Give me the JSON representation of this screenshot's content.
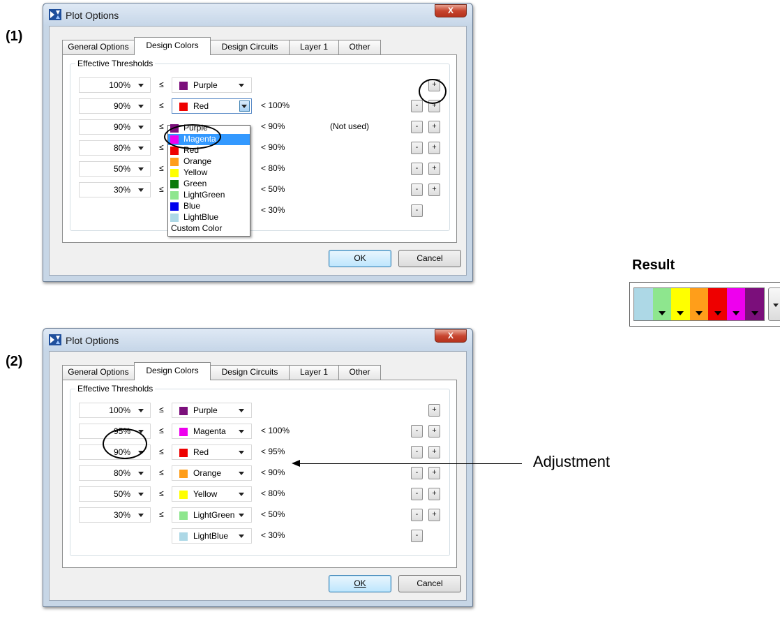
{
  "steps": [
    "(1)",
    "(2)"
  ],
  "dialog": {
    "title": "Plot Options",
    "close_glyph": "X",
    "tabs": [
      "General Options",
      "Design Colors",
      "Design Circuits",
      "Layer 1",
      "Other"
    ],
    "group_title": "Effective Thresholds",
    "le_symbol": "≤",
    "ok_label": "OK",
    "cancel_label": "Cancel",
    "minus": "-",
    "plus": "+"
  },
  "colors": {
    "Purple": "#7b0f7b",
    "Magenta": "#ee00ee",
    "Red": "#ee0000",
    "Orange": "#ff9e1a",
    "Yellow": "#ffff00",
    "Green": "#0b7a0b",
    "LightGreen": "#8ee68e",
    "Blue": "#0000ee",
    "LightBlue": "#add8e6"
  },
  "dialog1": {
    "rows": [
      {
        "pct": "100%",
        "color": "Purple",
        "lt": ""
      },
      {
        "pct": "90%",
        "color": "Red",
        "lt": "< 100%"
      },
      {
        "pct": "90%",
        "color": "",
        "lt": "< 90%",
        "note": "(Not used)"
      },
      {
        "pct": "80%",
        "color": "",
        "lt": "< 90%"
      },
      {
        "pct": "50%",
        "color": "",
        "lt": "< 80%"
      },
      {
        "pct": "30%",
        "color": "",
        "lt": "< 50%"
      },
      {
        "pct": "",
        "color": "",
        "lt": "< 30%"
      }
    ],
    "dropdown_items": [
      "Purple",
      "Magenta",
      "Red",
      "Orange",
      "Yellow",
      "Green",
      "LightGreen",
      "Blue",
      "LightBlue"
    ],
    "dropdown_selected": "Magenta",
    "custom_color_label": "Custom Color"
  },
  "dialog2": {
    "rows": [
      {
        "pct": "100%",
        "color": "Purple",
        "lt": ""
      },
      {
        "pct": "95%",
        "color": "Magenta",
        "lt": "< 100%"
      },
      {
        "pct": "90%",
        "color": "Red",
        "lt": "< 95%"
      },
      {
        "pct": "80%",
        "color": "Orange",
        "lt": "< 90%"
      },
      {
        "pct": "50%",
        "color": "Yellow",
        "lt": "< 80%"
      },
      {
        "pct": "30%",
        "color": "LightGreen",
        "lt": "< 50%"
      },
      {
        "pct": "",
        "color": "LightBlue",
        "lt": "< 30%"
      }
    ]
  },
  "result": {
    "label": "Result",
    "swatches": [
      "LightBlue",
      "LightGreen",
      "Yellow",
      "Orange",
      "Red",
      "Magenta",
      "Purple"
    ]
  },
  "adjustment_label": "Adjustment"
}
